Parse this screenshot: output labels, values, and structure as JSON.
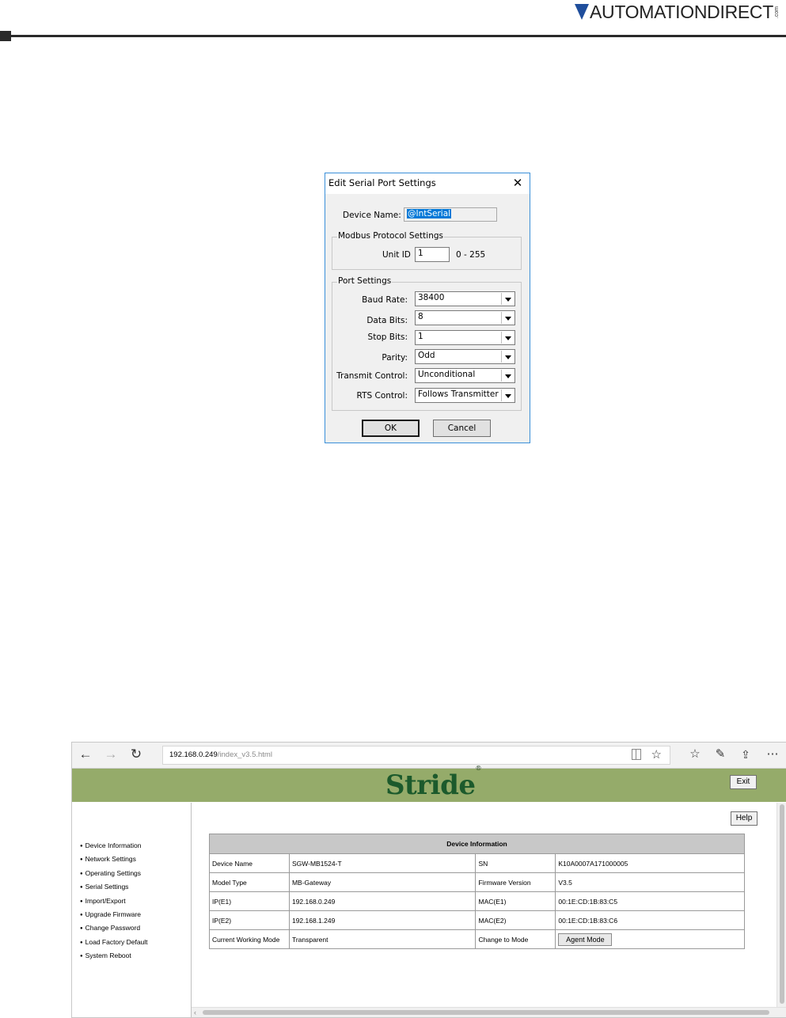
{
  "header": {
    "brand": "AUTOMATIONDIRECT",
    "brand_suffix": ".com",
    "brand_color": "#1f4e9c"
  },
  "dialog": {
    "title": "Edit Serial Port Settings",
    "close_icon": "close-icon",
    "device_name_label": "Device Name:",
    "device_name_value": "@IntSerial",
    "modbus_group_label": "Modbus Protocol Settings",
    "unit_id_label": "Unit ID",
    "unit_id_value": "1",
    "unit_id_range": "0 - 255",
    "port_group_label": "Port Settings",
    "fields": [
      {
        "label": "Baud Rate:",
        "value": "38400"
      },
      {
        "label": "Data Bits:",
        "value": "8"
      },
      {
        "label": "Stop Bits:",
        "value": "1"
      },
      {
        "label": "Parity:",
        "value": "Odd"
      },
      {
        "label": "Transmit Control:",
        "value": "Unconditional"
      },
      {
        "label": "RTS Control:",
        "value": "Follows Transmitter"
      }
    ],
    "ok_label": "OK",
    "cancel_label": "Cancel"
  },
  "browser": {
    "url_host": "192.168.0.249",
    "url_path": "/index_v3.5.html",
    "banner_color": "#95ab6a",
    "logo": "Stride",
    "logo_mark": "®",
    "exit_label": "Exit",
    "help_label": "Help",
    "nav_items": [
      "Device Information",
      "Network Settings",
      "Operating Settings",
      "Serial Settings",
      "Import/Export",
      "Upgrade Firmware",
      "Change Password",
      "Load Factory Default",
      "System Reboot"
    ],
    "table": {
      "title": "Device Information",
      "rows": [
        {
          "k1": "Device Name",
          "v1": "SGW-MB1524-T",
          "k2": "SN",
          "v2": "K10A0007A171000005"
        },
        {
          "k1": "Model Type",
          "v1": "MB-Gateway",
          "k2": "Firmware Version",
          "v2": "V3.5"
        },
        {
          "k1": "IP(E1)",
          "v1": "192.168.0.249",
          "k2": "MAC(E1)",
          "v2": "00:1E:CD:1B:83:C5"
        },
        {
          "k1": "IP(E2)",
          "v1": "192.168.1.249",
          "k2": "MAC(E2)",
          "v2": "00:1E:CD:1B:83:C6"
        }
      ],
      "mode_label": "Current Working Mode",
      "mode_value": "Transparent",
      "change_label": "Change to Mode",
      "agent_button": "Agent   Mode"
    }
  }
}
